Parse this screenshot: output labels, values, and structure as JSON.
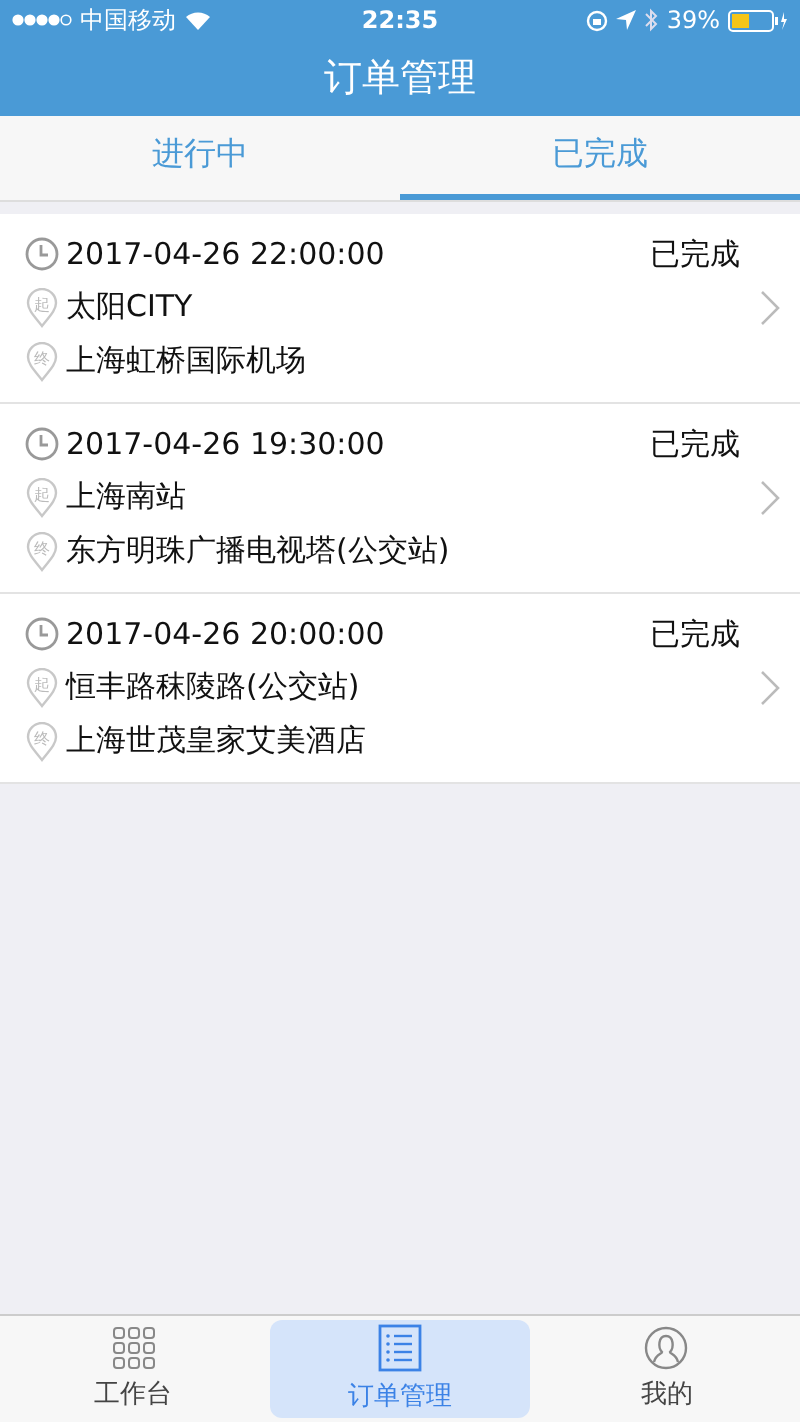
{
  "status_bar": {
    "carrier": "中国移动",
    "time": "22:35",
    "battery": "39%"
  },
  "header": {
    "title": "订单管理"
  },
  "tabs": [
    {
      "label": "进行中",
      "selected": false
    },
    {
      "label": "已完成",
      "selected": true
    }
  ],
  "orders": [
    {
      "time": "2017-04-26 22:00:00",
      "status": "已完成",
      "from_mark": "起",
      "from": "太阳CITY",
      "to_mark": "终",
      "to": "上海虹桥国际机场"
    },
    {
      "time": "2017-04-26 19:30:00",
      "status": "已完成",
      "from_mark": "起",
      "from": "上海南站",
      "to_mark": "终",
      "to": "东方明珠广播电视塔(公交站)"
    },
    {
      "time": "2017-04-26 20:00:00",
      "status": "已完成",
      "from_mark": "起",
      "from": "恒丰路秣陵路(公交站)",
      "to_mark": "终",
      "to": "上海世茂皇家艾美酒店"
    }
  ],
  "tab_bar": [
    {
      "kind": "grid",
      "label": "工作台",
      "selected": false
    },
    {
      "kind": "list",
      "label": "订单管理",
      "selected": true
    },
    {
      "kind": "person",
      "label": "我的",
      "selected": false
    }
  ]
}
